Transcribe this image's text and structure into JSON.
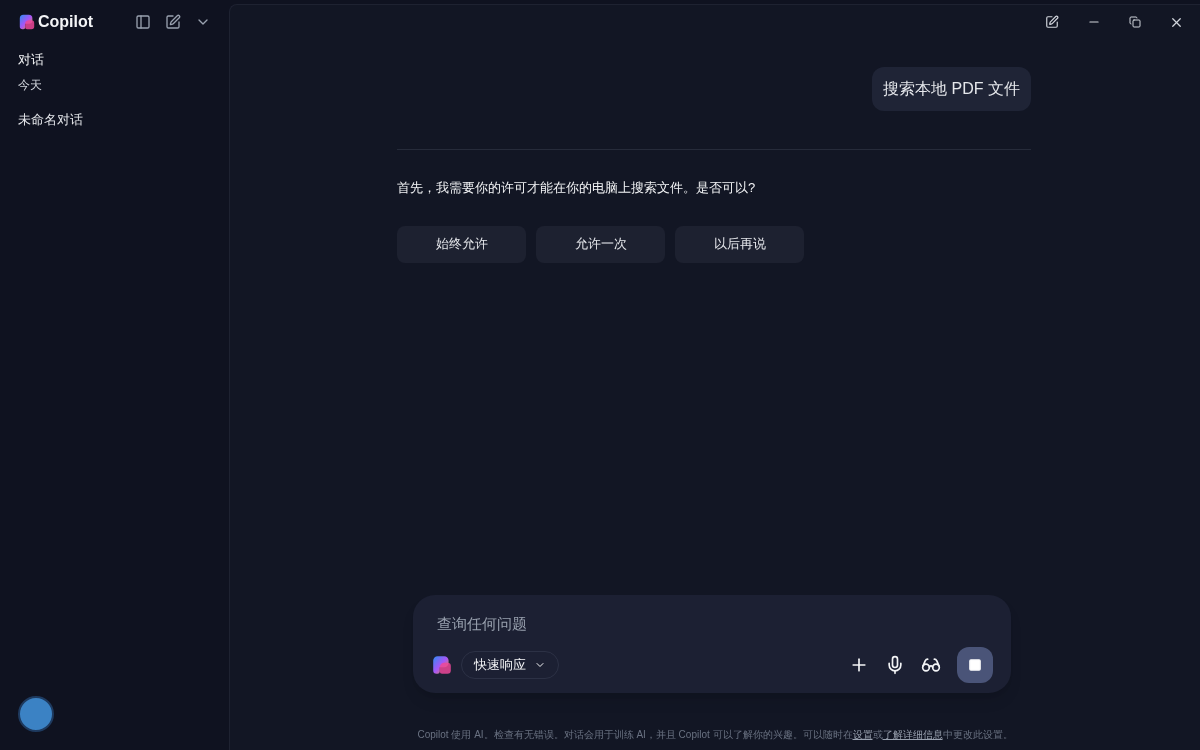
{
  "sidebar": {
    "brand": "Copilot",
    "section_title": "对话",
    "groups": [
      {
        "label": "今天",
        "items": [
          {
            "title": "未命名对话"
          }
        ]
      }
    ]
  },
  "conversation": {
    "user_message": "搜索本地 PDF 文件",
    "assistant_message": "首先，我需要你的许可才能在你的电脑上搜索文件。是否可以?",
    "actions": [
      "始终允许",
      "允许一次",
      "以后再说"
    ]
  },
  "composer": {
    "placeholder": "查询任何问题",
    "mode": "快速响应"
  },
  "footer": [
    {
      "kind": "text",
      "text": "Copilot 使用 AI。检查有无错误。对话会用于训练 AI，并且 Copilot 可以了解你的兴趣。可以随时在"
    },
    {
      "kind": "link",
      "text": "设置"
    },
    {
      "kind": "text",
      "text": "或"
    },
    {
      "kind": "link",
      "text": "了解详细信息"
    },
    {
      "kind": "text",
      "text": "中更改此设置。"
    }
  ]
}
